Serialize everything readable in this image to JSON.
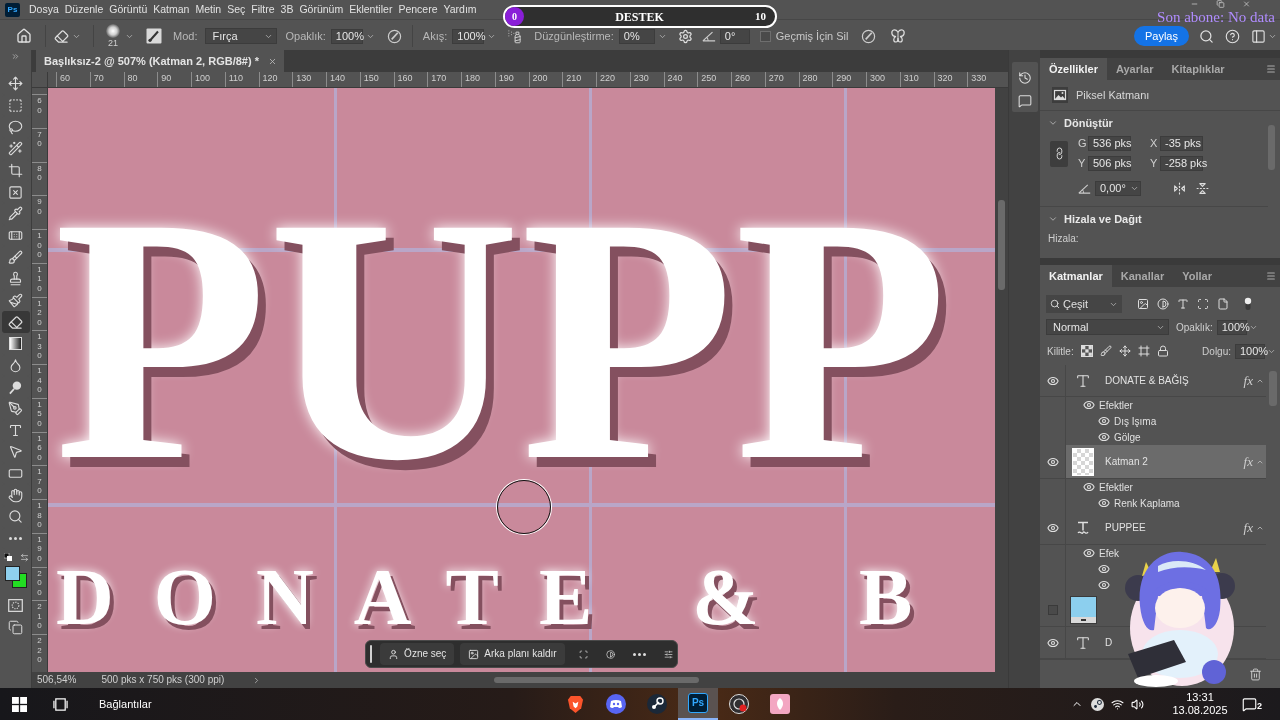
{
  "menu_bar": {
    "app_logo": "Ps",
    "items": [
      "Dosya",
      "Düzenle",
      "Görüntü",
      "Katman",
      "Metin",
      "Seç",
      "Filtre",
      "3B",
      "Görünüm",
      "Eklentiler",
      "Pencere",
      "Yardım"
    ]
  },
  "goal_overlay": {
    "current": "0",
    "label": "DESTEK",
    "target": "10",
    "level": 0
  },
  "subscriber_overlay": {
    "text": "Son abone: No data"
  },
  "options_bar": {
    "brush_size": "21",
    "mode": {
      "label": "Mod:",
      "value": "Fırça"
    },
    "opacity": {
      "label": "Opaklık:",
      "value": "100%"
    },
    "flow": {
      "label": "Akış:",
      "value": "100%"
    },
    "smoothing": {
      "label": "Düzgünleştirme:",
      "value": "0%"
    },
    "angle": {
      "value": "0°"
    },
    "erase_to_history": {
      "label": "Geçmiş İçin Sil",
      "checked": false
    },
    "share_button": "Paylaş"
  },
  "document_tab": {
    "title": "Başlıksız-2 @ 507% (Katman 2, RGB/8#) *"
  },
  "tools": [
    {
      "selected": false
    },
    {
      "selected": false
    },
    {
      "selected": false
    },
    {
      "selected": false
    },
    {
      "selected": false
    },
    {
      "selected": false
    },
    {
      "selected": false
    },
    {
      "selected": false
    },
    {
      "selected": false
    },
    {
      "selected": false
    },
    {
      "selected": false
    },
    {
      "selected": true
    },
    {
      "selected": false
    },
    {
      "selected": false
    },
    {
      "selected": false
    },
    {
      "selected": false
    },
    {
      "selected": false
    },
    {
      "selected": false
    },
    {
      "selected": false
    },
    {
      "selected": false
    },
    {
      "selected": false
    },
    {
      "selected": false
    }
  ],
  "rulers": {
    "horizontal": [
      "60",
      "70",
      "80",
      "90",
      "100",
      "110",
      "120",
      "130",
      "140",
      "150",
      "160",
      "170",
      "180",
      "190",
      "200",
      "210",
      "220",
      "230",
      "240",
      "250",
      "260",
      "270",
      "280",
      "290",
      "300",
      "310",
      "320",
      "330"
    ],
    "vertical": [
      "60",
      "70",
      "80",
      "90",
      "100",
      "110",
      "120",
      "130",
      "140",
      "150",
      "160",
      "170",
      "180",
      "190",
      "200",
      "210",
      "220"
    ]
  },
  "canvas": {
    "headline": "PUPP",
    "subline": "DONATE & B"
  },
  "contextual_bar": {
    "buttons": [
      "Özne seç",
      "Arka planı kaldır"
    ]
  },
  "status_bar": {
    "zoom": "506,54%",
    "document_size": "500 pks x 750 pks (300 ppi)"
  },
  "properties_panel": {
    "tabs": [
      {
        "label": "Özellikler",
        "selected": true
      },
      {
        "label": "Ayarlar",
        "selected": false
      },
      {
        "label": "Kitaplıklar",
        "selected": false
      }
    ],
    "layer_type": "Piksel Katmanı",
    "transform": {
      "title": "Dönüştür",
      "expanded": true,
      "fields": [
        {
          "label": "G",
          "value": "536 pks"
        },
        {
          "label": "X",
          "value": "-35 pks"
        },
        {
          "label": "Y",
          "value": "506 pks"
        },
        {
          "label": "Y",
          "value": "-258 pks"
        }
      ],
      "angle": "0,00°"
    },
    "align": {
      "title": "Hizala ve Dağıt",
      "expanded": true,
      "label": "Hizala:"
    }
  },
  "layers_panel": {
    "tabs": [
      {
        "label": "Katmanlar",
        "selected": true
      },
      {
        "label": "Kanallar",
        "selected": false
      },
      {
        "label": "Yollar",
        "selected": false
      }
    ],
    "filter": "Çeşit",
    "blend_mode": "Normal",
    "opacity_label": "Opaklık:",
    "opacity_value": "100%",
    "lock_label": "Kilitle:",
    "fill_label": "Dolgu:",
    "fill_value": "100%",
    "layers": [
      {
        "kind": "text",
        "name": "DONATE & BAĞIŞ",
        "visible": true,
        "selected": false,
        "fx": "fx",
        "expanded": true,
        "effects_label": "Efektler",
        "effects_visible": true,
        "effects": [
          {
            "name": "Dış Işıma",
            "visible": true
          },
          {
            "name": "Gölge",
            "visible": true
          }
        ]
      },
      {
        "kind": "pixel",
        "name": "Katman 2",
        "visible": true,
        "selected": true,
        "fx": "fx",
        "expanded": true,
        "effects_label": "Efektler",
        "effects_visible": true,
        "effects": [
          {
            "name": "Renk Kaplama",
            "visible": true
          }
        ]
      },
      {
        "kind": "warped_text",
        "name": "PUPPEE",
        "visible": true,
        "selected": false,
        "fx": "fx",
        "expanded": true,
        "effects_label": "Efek",
        "effects_visible": true,
        "effects": [
          {
            "visible": true
          },
          {
            "visible": true
          }
        ]
      },
      {
        "kind": "image",
        "visible": false,
        "selected": false
      },
      {
        "kind": "text",
        "name": "D",
        "visible": true,
        "selected": false
      }
    ]
  },
  "taskbar": {
    "widgets": "Bağlantılar",
    "apps": [
      {
        "selected": false
      },
      {
        "selected": false
      },
      {
        "selected": false
      },
      {
        "logo": "Ps",
        "selected": true
      },
      {
        "selected": false
      },
      {
        "selected": false
      }
    ],
    "time": "13:31",
    "date": "13.08.2025",
    "notifications": "2"
  }
}
